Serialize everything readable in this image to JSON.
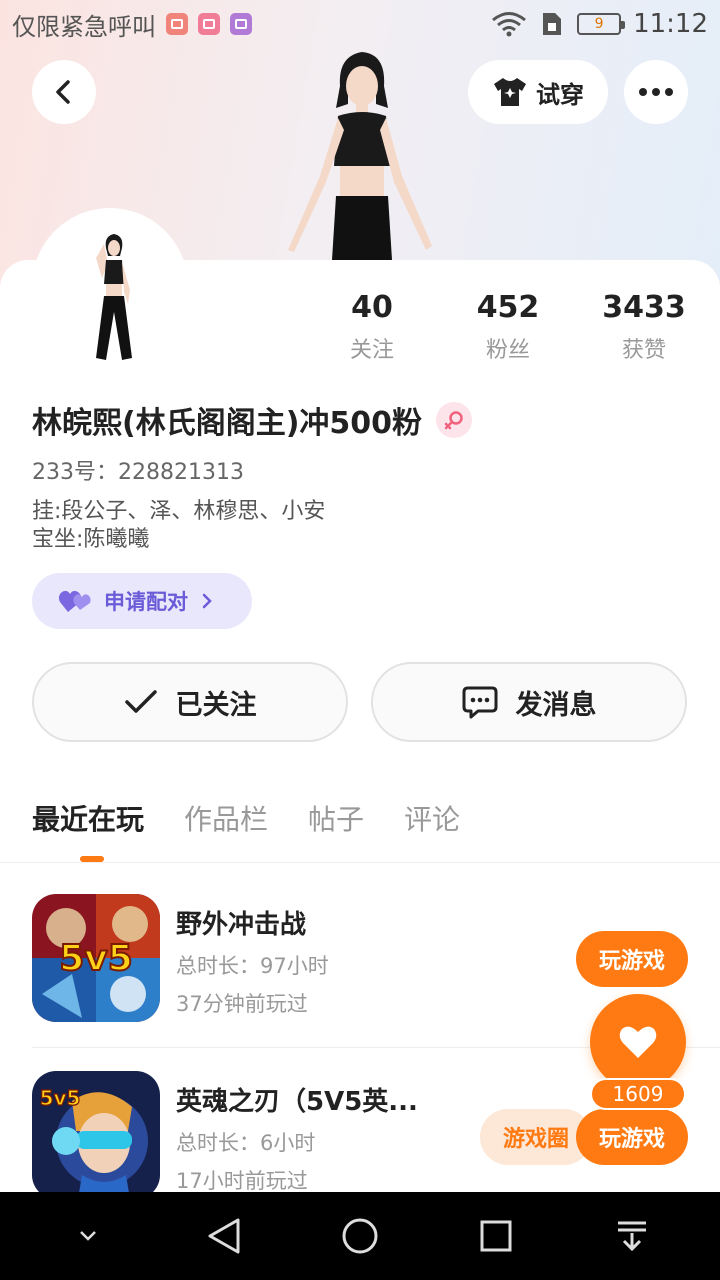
{
  "status_bar": {
    "carrier": "仅限紧急呼叫",
    "battery": "9",
    "time": "11:12"
  },
  "header": {
    "try_on_label": "试穿"
  },
  "profile": {
    "stats": [
      {
        "value": "40",
        "label": "关注"
      },
      {
        "value": "452",
        "label": "粉丝"
      },
      {
        "value": "3433",
        "label": "获赞"
      }
    ],
    "nickname": "林皖熙(林氏阁阁主)冲500粉",
    "uid": "233号：228821313",
    "bio_line1": "挂:段公子、泽、林穆思、小安",
    "bio_line2": "宝坐:陈曦曦",
    "pair_label": "申请配对",
    "follow_label": "已关注",
    "message_label": "发消息"
  },
  "tabs": [
    {
      "label": "最近在玩",
      "active": true
    },
    {
      "label": "作品栏",
      "active": false
    },
    {
      "label": "帖子",
      "active": false
    },
    {
      "label": "评论",
      "active": false
    }
  ],
  "games": [
    {
      "title": "野外冲击战",
      "duration": "总时长：97小时",
      "last_played": "37分钟前玩过",
      "icon_text": "5v5",
      "play_label": "玩游戏"
    },
    {
      "title": "英魂之刃（5V5英...",
      "duration": "总时长：6小时",
      "last_played": "17小时前玩过",
      "icon_text": "5v5",
      "circle_label": "游戏圈",
      "play_label": "玩游戏"
    }
  ],
  "like": {
    "count": "1609"
  },
  "colors": {
    "accent": "#ff7a12",
    "pair_text": "#6c5bd8",
    "pair_bg": "#e9e7fb"
  }
}
